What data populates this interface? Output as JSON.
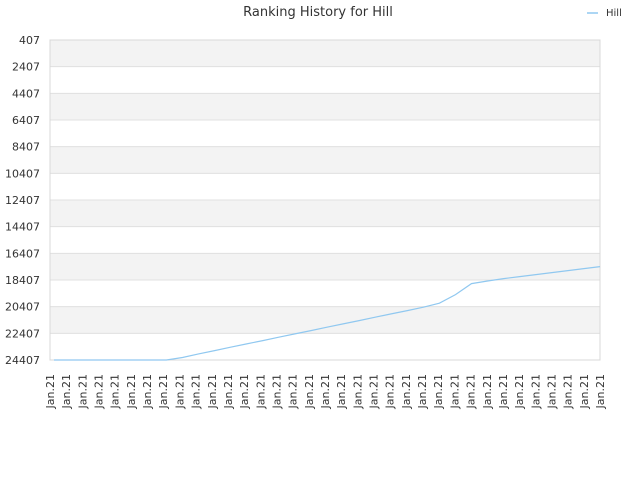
{
  "chart_data": {
    "type": "line",
    "title": "Ranking History for Hill",
    "xlabel": "",
    "ylabel": "",
    "y_inverted": true,
    "ylim": [
      407,
      24407
    ],
    "y_ticks": [
      "407",
      "2407",
      "4407",
      "6407",
      "8407",
      "10407",
      "12407",
      "14407",
      "16407",
      "18407",
      "20407",
      "22407",
      "24407"
    ],
    "x_tick_labels": [
      "Jan.21",
      "Jan.21",
      "Jan.21",
      "Jan.21",
      "Jan.21",
      "Jan.21",
      "Jan.21",
      "Jan.21",
      "Jan.21",
      "Jan.21",
      "Jan.21",
      "Jan.21",
      "Jan.21",
      "Jan.21",
      "Jan.21",
      "Jan.21",
      "Jan.21",
      "Jan.21",
      "Jan.21",
      "Jan.21",
      "Jan.21",
      "Jan.21",
      "Jan.21",
      "Jan.21",
      "Jan.21",
      "Jan.21",
      "Jan.21",
      "Jan.21",
      "Jan.21",
      "Jan.21",
      "Jan.21",
      "Jan.21",
      "Jan.21",
      "Jan.21",
      "Jan.21"
    ],
    "grid": true,
    "legend_position": "top-right",
    "series": [
      {
        "name": "Hill",
        "color": "#90c8f0",
        "values": [
          24407,
          24407,
          24407,
          24407,
          24407,
          24407,
          24407,
          24407,
          24220,
          23950,
          23700,
          23450,
          23200,
          22950,
          22700,
          22450,
          22200,
          21950,
          21700,
          21450,
          21200,
          20950,
          20700,
          20450,
          20150,
          19500,
          18680,
          18480,
          18300,
          18150,
          18000,
          17850,
          17700,
          17550,
          17400
        ]
      }
    ]
  }
}
